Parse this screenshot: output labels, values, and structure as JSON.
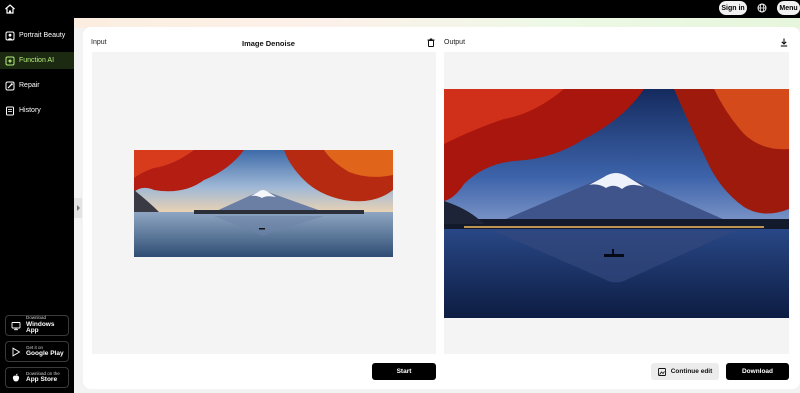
{
  "topbar": {
    "home_icon": "home-icon",
    "signin_label": "Sign in",
    "globe_icon": "globe-icon",
    "menu_label": "Menu"
  },
  "sidebar": {
    "items": [
      {
        "label": "Portrait Beauty",
        "icon": "portrait-icon",
        "active": false
      },
      {
        "label": "Function AI",
        "icon": "sparkle-icon",
        "active": true
      },
      {
        "label": "Repair",
        "icon": "repair-icon",
        "active": false
      },
      {
        "label": "History",
        "icon": "history-icon",
        "active": false
      }
    ],
    "stores": [
      {
        "small": "Download",
        "big": "Windows App",
        "icon": "monitor-icon"
      },
      {
        "small": "Get it on",
        "big": "Google Play",
        "icon": "play-icon"
      },
      {
        "small": "Download on the",
        "big": "App Store",
        "icon": "apple-icon"
      }
    ]
  },
  "editor": {
    "input_label": "Input",
    "title": "Image Denoise",
    "output_label": "Output",
    "start_label": "Start",
    "continue_label": "Continue edit",
    "download_label": "Download"
  },
  "colors": {
    "accent": "#b6f07a",
    "active_bg": "#1c2a12",
    "dark": "#000000",
    "panel_bg": "#f4f4f4"
  }
}
